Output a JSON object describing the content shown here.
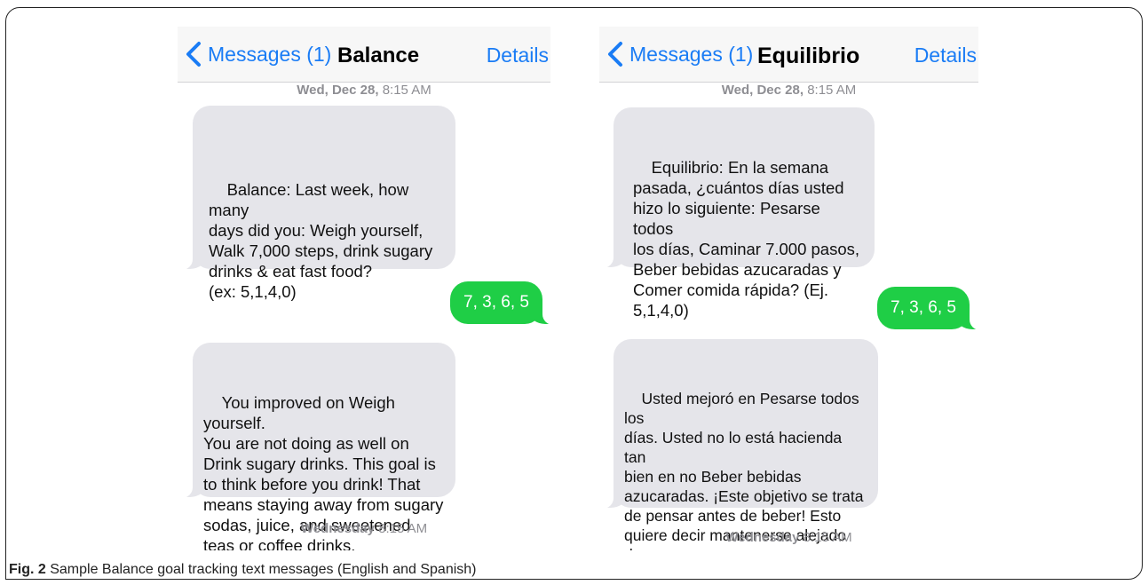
{
  "left_phone": {
    "back_label": "Messages (1)",
    "title": "Balance",
    "details_label": "Details",
    "timestamp_top_day": "Wed, Dec 28,",
    "timestamp_top_time": "8:15 AM",
    "message_1": "Balance: Last week, how many\ndays did you: Weigh yourself,\nWalk 7,000 steps, drink sugary\ndrinks & eat fast food?\n(ex: 5,1,4,0)",
    "reply": "7, 3, 6, 5",
    "message_2": "You improved on Weigh yourself.\nYou are not doing as well on\nDrink sugary drinks. This goal is\nto think before you drink! That\nmeans staying away from sugary\nsodas, juice, and sweetened\nteas or coffee drinks.",
    "timestamp_bottom_day": "Wednesday",
    "timestamp_bottom_time": "8:15 AM"
  },
  "right_phone": {
    "back_label": "Messages (1)",
    "title": "Equilibrio",
    "details_label": "Details",
    "timestamp_top_day": "Wed, Dec 28,",
    "timestamp_top_time": "8:15 AM",
    "message_1": "Equilibrio: En la semana\npasada, ¿cuántos días usted\nhizo lo siguiente: Pesarse todos\nlos días, Caminar 7.000 pasos,\nBeber bebidas azucaradas y\nComer comida rápida? (Ej.\n5,1,4,0)",
    "reply": "7, 3, 6, 5",
    "message_2": "Usted mejoró en Pesarse todos los\ndías. Usted no lo está hacienda tan\nbien en no Beber bebidas\nazucaradas. ¡Este objetivo se trata\nde pensar antes de beber! Esto\nquiere decir mantenerse alejado de\nbebidas azucaradas, jugo y tés\nendulzados o bebidas con café.",
    "timestamp_bottom_day": "Wednesday",
    "timestamp_bottom_time": "8:15 AM"
  },
  "caption": {
    "label": "Fig. 2",
    "text": "Sample Balance goal tracking text messages (English and Spanish)"
  },
  "colors": {
    "ios_blue": "#1a7cf5",
    "incoming_bubble": "#e5e5ea",
    "outgoing_bubble": "#1fce46"
  }
}
